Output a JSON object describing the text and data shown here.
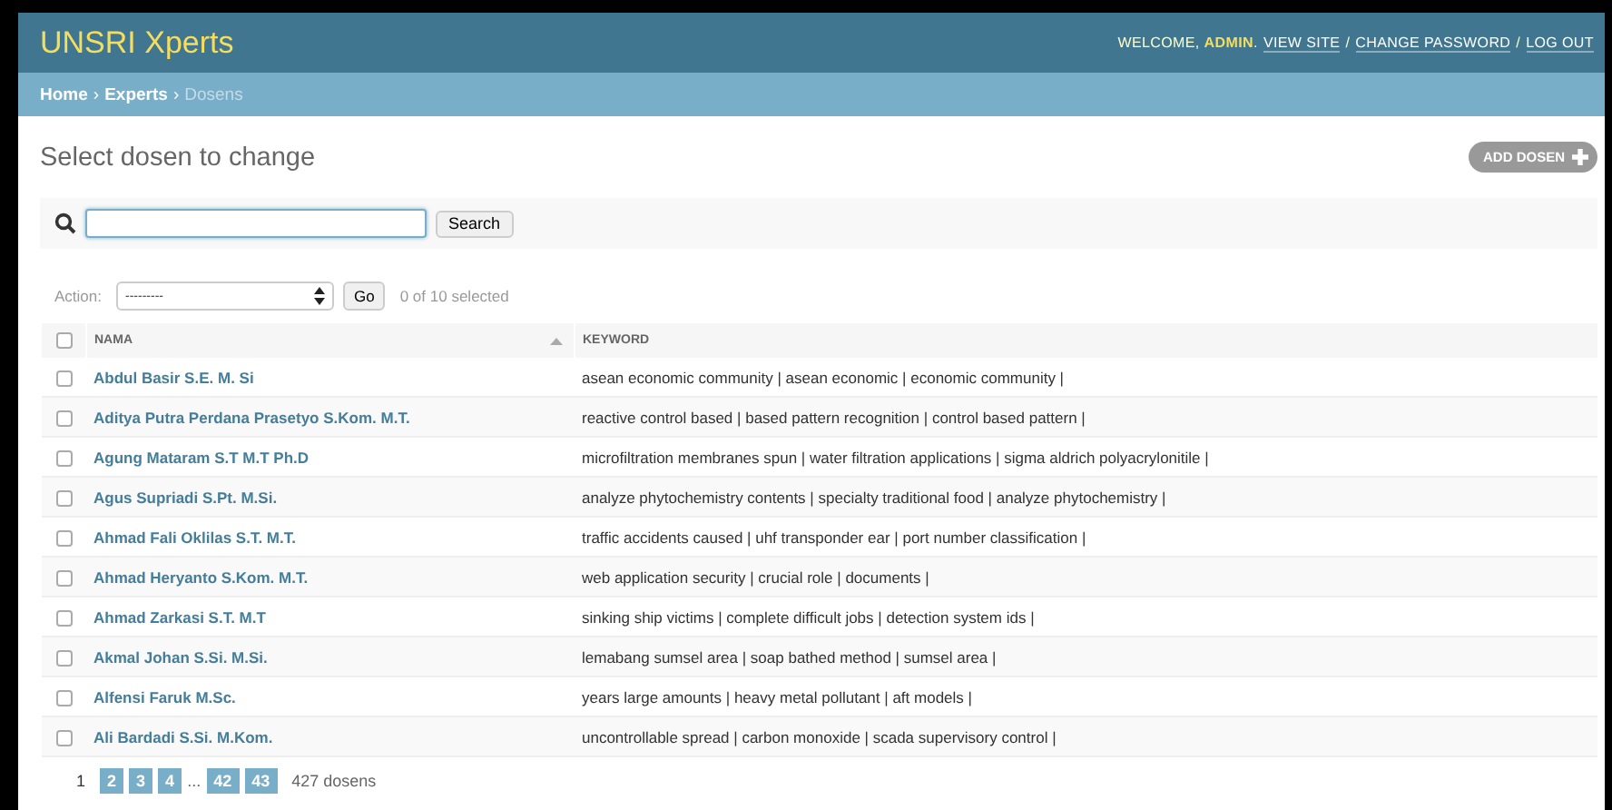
{
  "header": {
    "brand": "UNSRI Xperts",
    "welcome": "WELCOME, **ADMIN**.",
    "links": [
      "VIEW SITE",
      "CHANGE PASSWORD",
      "LOG OUT"
    ],
    "link_separator": "/"
  },
  "breadcrumbs": [
    {
      "label": "Home",
      "link": true
    },
    {
      "label": "Experts",
      "link": true
    },
    {
      "label": "Dosens",
      "link": false
    }
  ],
  "breadcrumb_separator": "›",
  "page_title": "Select dosen to change",
  "add_button": "ADD DOSEN",
  "search": {
    "button": "Search"
  },
  "actions": {
    "label": "Action:",
    "value": "---------",
    "go": "Go",
    "counter": "0 of 10 selected"
  },
  "table": {
    "all_checked": false,
    "columns": [
      {
        "label": "NAMA",
        "sorted": true
      },
      {
        "label": "KEYWORD",
        "sorted": false
      }
    ],
    "rows": [
      {
        "nama": "Abdul Basir S.E. M. Si",
        "keyword": "asean economic community | asean economic | economic community |",
        "checked": false
      },
      {
        "nama": "Aditya Putra Perdana Prasetyo S.Kom. M.T.",
        "keyword": "reactive control based | based pattern recognition | control based pattern |",
        "checked": false
      },
      {
        "nama": "Agung Mataram S.T M.T Ph.D",
        "keyword": "microfiltration membranes spun | water filtration applications | sigma aldrich polyacrylonitile |",
        "checked": false
      },
      {
        "nama": "Agus Supriadi S.Pt. M.Si.",
        "keyword": "analyze phytochemistry contents | specialty traditional food | analyze phytochemistry |",
        "checked": false
      },
      {
        "nama": "Ahmad Fali Oklilas S.T. M.T.",
        "keyword": "traffic accidents caused | uhf transponder ear | port number classification |",
        "checked": false
      },
      {
        "nama": "Ahmad Heryanto S.Kom. M.T.",
        "keyword": "web application security | crucial role | documents |",
        "checked": false
      },
      {
        "nama": "Ahmad Zarkasi S.T. M.T",
        "keyword": "sinking ship victims | complete difficult jobs | detection system ids |",
        "checked": false
      },
      {
        "nama": "Akmal Johan S.Si. M.Si.",
        "keyword": "lemabang sumsel area | soap bathed method | sumsel area |",
        "checked": false
      },
      {
        "nama": "Alfensi Faruk M.Sc.",
        "keyword": "years large amounts | heavy metal pollutant | aft models |",
        "checked": false
      },
      {
        "nama": "Ali Bardadi S.Si. M.Kom.",
        "keyword": "uncontrollable spread | carbon monoxide | scada supervisory control |",
        "checked": false
      }
    ]
  },
  "pagination": {
    "pages": [
      {
        "label": "1",
        "kind": "current"
      },
      {
        "label": "2",
        "kind": "page"
      },
      {
        "label": "3",
        "kind": "page"
      },
      {
        "label": "4",
        "kind": "page"
      },
      {
        "label": "...",
        "kind": "ellipsis"
      },
      {
        "label": "42",
        "kind": "page"
      },
      {
        "label": "43",
        "kind": "page"
      }
    ],
    "count": "427 dosens"
  }
}
